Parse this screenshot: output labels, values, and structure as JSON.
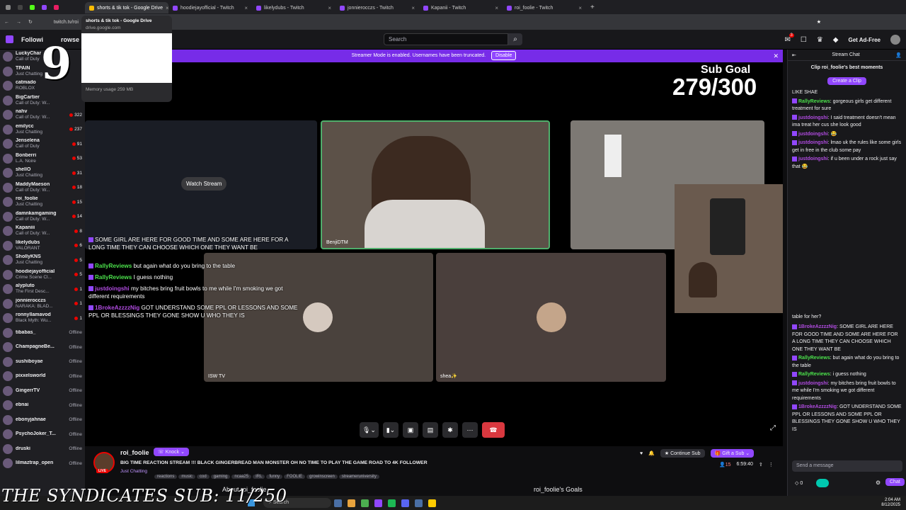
{
  "browser": {
    "tabs": [
      {
        "label": "shorts & tik tok - Google Drive",
        "active": true
      },
      {
        "label": "hoodiejayofficial - Twitch"
      },
      {
        "label": "likelydubs - Twitch"
      },
      {
        "label": "jonnierocczs - Twitch"
      },
      {
        "label": "Kapanii - Twitch"
      },
      {
        "label": "roi_foolie - Twitch"
      }
    ],
    "url": "twitch.tv/roi",
    "tooltip": {
      "title": "shorts & tik tok - Google Drive",
      "domain": "drive.google.com",
      "memory": "Memory usage 259 MB"
    }
  },
  "twitch": {
    "following_label": "Followi",
    "browse_label": "rowse",
    "search_placeholder": "Search",
    "notif_count": "3",
    "adfree": "Get Ad-Free"
  },
  "sidebar": {
    "channels": [
      {
        "name": "LuckyChar",
        "cat": "Call of Duty",
        "live": true,
        "viewers": ""
      },
      {
        "name": "TPAIN",
        "cat": "Just Chatting",
        "live": true,
        "viewers": ""
      },
      {
        "name": "catmado",
        "cat": "ROBLOX",
        "live": true,
        "viewers": ""
      },
      {
        "name": "BigCartier",
        "cat": "Call of Duty: W...",
        "live": true,
        "viewers": ""
      },
      {
        "name": "nahv",
        "cat": "Call of Duty: W...",
        "live": true,
        "viewers": "322"
      },
      {
        "name": "emilycc",
        "cat": "Just Chatting",
        "live": true,
        "viewers": "237"
      },
      {
        "name": "Jenselena",
        "cat": "Call of Duty",
        "live": true,
        "viewers": "91"
      },
      {
        "name": "Bonberri",
        "cat": "L.A. Noire",
        "live": true,
        "viewers": "53"
      },
      {
        "name": "shellO",
        "cat": "Just Chatting",
        "live": true,
        "viewers": "31"
      },
      {
        "name": "MaddyMaeson",
        "cat": "Call of Duty: W...",
        "live": true,
        "viewers": "18"
      },
      {
        "name": "roi_foolie",
        "cat": "Just Chatting",
        "live": true,
        "viewers": "15"
      },
      {
        "name": "damnkamgaming",
        "cat": "Call of Duty: W...",
        "live": true,
        "viewers": "14"
      },
      {
        "name": "Kapaniii",
        "cat": "Call of Duty: W...",
        "live": true,
        "viewers": "8"
      },
      {
        "name": "likelydubs",
        "cat": "VALORANT",
        "live": true,
        "viewers": "6"
      },
      {
        "name": "ShollyKNS",
        "cat": "Just Chatting",
        "live": true,
        "viewers": "5"
      },
      {
        "name": "hoodiejayofficial",
        "cat": "Crime Scene Cl...",
        "live": true,
        "viewers": "5"
      },
      {
        "name": "alypluto",
        "cat": "The First Desc...",
        "live": true,
        "viewers": "1"
      },
      {
        "name": "jonnierocczs",
        "cat": "NARAKA: BLAD...",
        "live": true,
        "viewers": "1"
      },
      {
        "name": "ronnyllamavod",
        "cat": "Black Myth: Wu...",
        "live": true,
        "viewers": "1"
      },
      {
        "name": "tibabas_",
        "cat": "",
        "live": false,
        "viewers": "Offline"
      },
      {
        "name": "ChampagneBe...",
        "cat": "",
        "live": false,
        "viewers": "Offline"
      },
      {
        "name": "sushiboyae",
        "cat": "",
        "live": false,
        "viewers": "Offline"
      },
      {
        "name": "pixxelsworld",
        "cat": "",
        "live": false,
        "viewers": "Offline"
      },
      {
        "name": "GingerrTV",
        "cat": "",
        "live": false,
        "viewers": "Offline"
      },
      {
        "name": "ebnai",
        "cat": "",
        "live": false,
        "viewers": "Offline"
      },
      {
        "name": "ebonyjahnae",
        "cat": "",
        "live": false,
        "viewers": "Offline"
      },
      {
        "name": "PsychoJoker_T...",
        "cat": "",
        "live": false,
        "viewers": "Offline"
      },
      {
        "name": "druski",
        "cat": "",
        "live": false,
        "viewers": "Offline"
      },
      {
        "name": "lilmaztrap_open",
        "cat": "",
        "live": false,
        "viewers": "Offline"
      }
    ]
  },
  "banner": {
    "text": "Streamer Mode is enabled. Usernames have been truncated.",
    "button": "Disable"
  },
  "video": {
    "subgoal_label": "Sub Goal",
    "subgoal_count": "279/300",
    "watch_stream": "Watch Stream",
    "tile_benji": "BenjiDTM",
    "tile_isw": "ISW TV",
    "tile_shea": "shea✨",
    "overlay_chat": [
      {
        "user": "",
        "msg": "SOME GIRL ARE HERE FOR GOOD TIME AND SOME ARE HERE FOR A LONG TIME THEY CAN CHOOSE WHICH ONE THEY WANT BE"
      },
      {
        "user": "RallyReviews",
        "msg": "but again what do you bring to the table"
      },
      {
        "user": "RallyReviews",
        "msg": "I guess nothing"
      },
      {
        "user": "justdoingshi",
        "msg": "my bitches bring fruit bowls to me while I'm smoking we got different requirements"
      },
      {
        "user": "1BrokeAzzzzNig",
        "msg": "GOT UNDERSTAND SOME PPL OR LESSONS AND SOME PPL OR BLESSINGS THEY GONE SHOW U WHO THEY IS"
      }
    ]
  },
  "stream_info": {
    "channel": "roi_foolie",
    "knock": "Knock",
    "title": "BIG TIME REACTION STREAM !!! BLACK GINGERBREAD MAN MONSTER OH NO TIME TO PLAY THE GAME ROAD TO 4K FOLLOWER",
    "category": "Just Chatting",
    "tags": [
      "reactions",
      "music",
      "cod",
      "gaming",
      "ncaa25",
      "IRL",
      "funny",
      "FOOLIE",
      "growinscreen",
      "streameruniversity"
    ],
    "viewers": "15",
    "uptime": "6:59:40",
    "continue_sub": "Continue Sub",
    "gift_sub": "Gift a Sub",
    "about": "About roi_foolie",
    "goals": "roi_foolie's Goals",
    "live": "LIVE"
  },
  "chat": {
    "header": "Stream Chat",
    "clip_title": "Clip roi_foolie's best moments",
    "create_clip": "Create a Clip",
    "top_partial": "LIKE SHAE",
    "messages": [
      {
        "user": "RallyReviews",
        "cls": "u-green",
        "msg": "gorgeous girls get different treatment for sure"
      },
      {
        "user": "justdoingshi",
        "cls": "u-purple",
        "msg": "I said treatment doesn't mean ima treat her cus she look good"
      },
      {
        "user": "justdoingshi",
        "cls": "u-purple",
        "msg": "😂"
      },
      {
        "user": "justdoingshi",
        "cls": "u-purple",
        "msg": "lmao uk the rules like some girls get in free in the club some pay"
      },
      {
        "user": "justdoingshi",
        "cls": "u-purple",
        "msg": "if u been under a rock just say that 😂"
      }
    ],
    "mid_partial": "table for her?",
    "messages2": [
      {
        "user": "1BrokeAzzzzNig",
        "cls": "u-purple",
        "msg": "SOME GIRL ARE HERE FOR GOOD TIME AND SOME ARE HERE FOR A LONG TIME THEY CAN CHOOSE WHICH ONE THEY WANT BE"
      },
      {
        "user": "RallyReviews",
        "cls": "u-green",
        "msg": "but again what do you bring to the table"
      },
      {
        "user": "RallyReviews",
        "cls": "u-green",
        "msg": "i guess nothing"
      },
      {
        "user": "justdoingshi",
        "cls": "u-purple",
        "msg": "my bitches bring fruit bowls to me while I'm smoking we got different requirements"
      },
      {
        "user": "1BrokeAzzzzNig",
        "cls": "u-purple",
        "msg": "GOT UNDERSTAND SOME PPL OR LESSONS AND SOME PPL OR BLESSINGS THEY GONE SHOW U WHO THEY IS"
      }
    ],
    "send_placeholder": "Send a message",
    "points": "0",
    "chat_button": "Chat"
  },
  "overlay": {
    "syndicates": "THE SYNDICATES SUB: 11/250"
  },
  "taskbar": {
    "search": "Search",
    "time": "2:04 AM",
    "date": "8/12/2025"
  }
}
